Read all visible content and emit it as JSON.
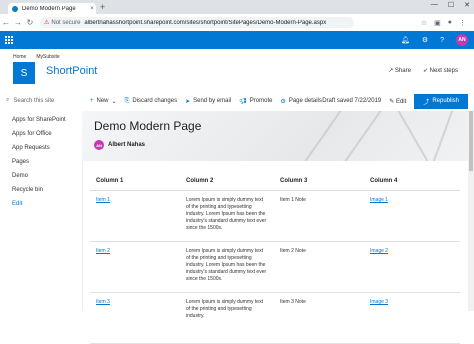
{
  "browser": {
    "tab_title": "Demo Modern Page",
    "tab_close": "×",
    "new_tab": "+",
    "not_secure": "Not secure",
    "url": "albertnahasshortpoint.sharepoint.com/sites/shortpoint/SitePages/Demo-Modern-Page.aspx",
    "window": {
      "minimize": "—",
      "maximize": "☐",
      "close": "✕"
    }
  },
  "suitebar": {
    "avatar_initials": "AN",
    "brand_color": "#0078d4"
  },
  "site": {
    "breadcrumbs": [
      "Home",
      "MySubsite"
    ],
    "logo_letter": "S",
    "name": "ShortPoint",
    "share": "Share",
    "next_steps": "Next steps"
  },
  "leftnav": {
    "search_placeholder": "Search this site",
    "items": [
      "Apps for SharePoint",
      "Apps for Office",
      "App Requests",
      "Pages",
      "Demo",
      "Recycle bin"
    ],
    "edit": "Edit"
  },
  "commandbar": {
    "new": "New",
    "discard": "Discard changes",
    "send": "Send by email",
    "promote": "Promote",
    "details": "Page details",
    "draft_status": "Draft saved 7/22/2019",
    "edit": "Edit",
    "republish": "Republish"
  },
  "page": {
    "title": "Demo Modern Page",
    "author_initials": "AN",
    "author": "Albert Nahas"
  },
  "table": {
    "headers": [
      "Column 1",
      "Column 2",
      "Column 3",
      "Column 4"
    ],
    "rows": [
      {
        "c1": "Item 1",
        "c2": "Lorem Ipsum is simply dummy text of the printing and typesetting industry. Lorem Ipsum has been the industry's standard dummy text ever since the 1500s.",
        "c3": "Item 1 Note",
        "c4": "Image 1"
      },
      {
        "c1": "Item 2",
        "c2": "Lorem Ipsum is simply dummy text of the printing and typesetting industry. Lorem Ipsum has been the industry's standard dummy text ever since the 1500s.",
        "c3": "Item 2 Note",
        "c4": "Image 2"
      },
      {
        "c1": "Item 3",
        "c2": "Lorem Ipsum is simply dummy text of the printing and typesetting industry.",
        "c3": "Item 3 Note",
        "c4": "Image 3"
      }
    ]
  }
}
